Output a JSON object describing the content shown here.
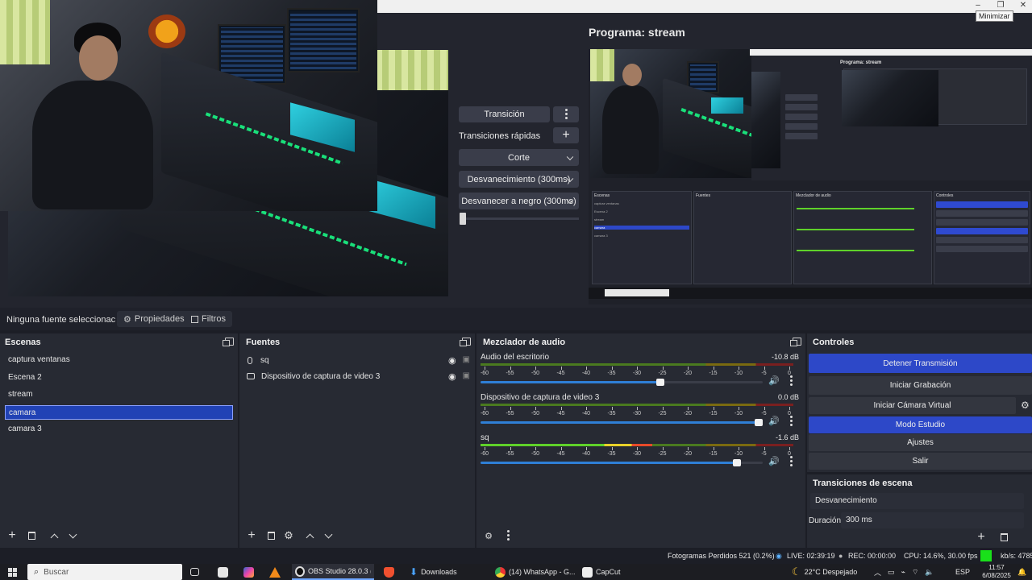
{
  "window": {
    "minimize_tooltip": "Minimizar"
  },
  "program": {
    "title": "Programa: stream"
  },
  "transitions_panel": {
    "transition_button": "Transición",
    "quick_transitions_label": "Transiciones rápidas",
    "options": [
      "Corte",
      "Desvanecimiento (300ms)",
      "Desvanecer a negro (300ms)"
    ],
    "tbar_position": 0.0
  },
  "source_bar": {
    "no_source": "Ninguna fuente seleccionac",
    "properties": "Propiedades",
    "filters": "Filtros"
  },
  "scenes": {
    "title": "Escenas",
    "items": [
      "captura ventanas",
      "Escena 2",
      "stream",
      "camara",
      "camara 3"
    ],
    "selected_index": 3
  },
  "sources": {
    "title": "Fuentes",
    "items": [
      {
        "name": "sq",
        "icon": "microphone-icon"
      },
      {
        "name": "Dispositivo de captura de video 3",
        "icon": "camera-icon"
      }
    ]
  },
  "mixer": {
    "title": "Mezclador de audio",
    "ticks": [
      "-60",
      "-55",
      "-50",
      "-45",
      "-40",
      "-35",
      "-30",
      "-25",
      "-20",
      "-15",
      "-10",
      "-5",
      "0"
    ],
    "channels": [
      {
        "name": "Audio del escritorio",
        "db": "-10.8 dB",
        "level": 0.0,
        "volume": 0.64
      },
      {
        "name": "Dispositivo de captura de video 3",
        "db": "0.0 dB",
        "level": 0.0,
        "volume": 1.0
      },
      {
        "name": "sq",
        "db": "-1.6 dB",
        "level": 0.55,
        "volume": 0.92
      }
    ]
  },
  "controls": {
    "title": "Controles",
    "stop_stream": "Detener Transmisión",
    "start_recording": "Iniciar Grabación",
    "start_virtual_cam": "Iniciar Cámara Virtual",
    "studio_mode": "Modo Estudio",
    "settings": "Ajustes",
    "exit": "Salir"
  },
  "scene_transitions": {
    "title": "Transiciones de escena",
    "current": "Desvanecimiento",
    "duration_label": "Duración",
    "duration_value": "300 ms"
  },
  "status": {
    "dropped_frames": "Fotogramas Perdidos 521 (0.2%)",
    "live": "LIVE: 02:39:19",
    "rec": "REC: 00:00:00",
    "cpu": "CPU: 14.6%, 30.00 fps",
    "kbps": "kb/s: 4785"
  },
  "taskbar": {
    "search_placeholder": "Buscar",
    "apps": [
      "OBS Studio 28.0.3 (...",
      "Downloads",
      "(14) WhatsApp - G...",
      "CapCut"
    ],
    "weather": "22°C  Despejado",
    "language": "ESP",
    "time": "11:57",
    "date": "6/08/2025"
  },
  "mini_obs": {
    "title": "Programa: stream",
    "scenes": [
      "captura ventanas",
      "Escena 2",
      "stream",
      "camara",
      "camara 3"
    ],
    "controls": [
      "Detener Transmisión",
      "Iniciar Grabación",
      "Iniciar Cámara Virtual",
      "Modo Estudio",
      "Ajustes",
      "Salir"
    ]
  },
  "colors": {
    "accent_blue": "#2d48c8",
    "dock_bg": "#272a33",
    "meter_green": "#5fd12a",
    "status_green": "#19e01a"
  }
}
